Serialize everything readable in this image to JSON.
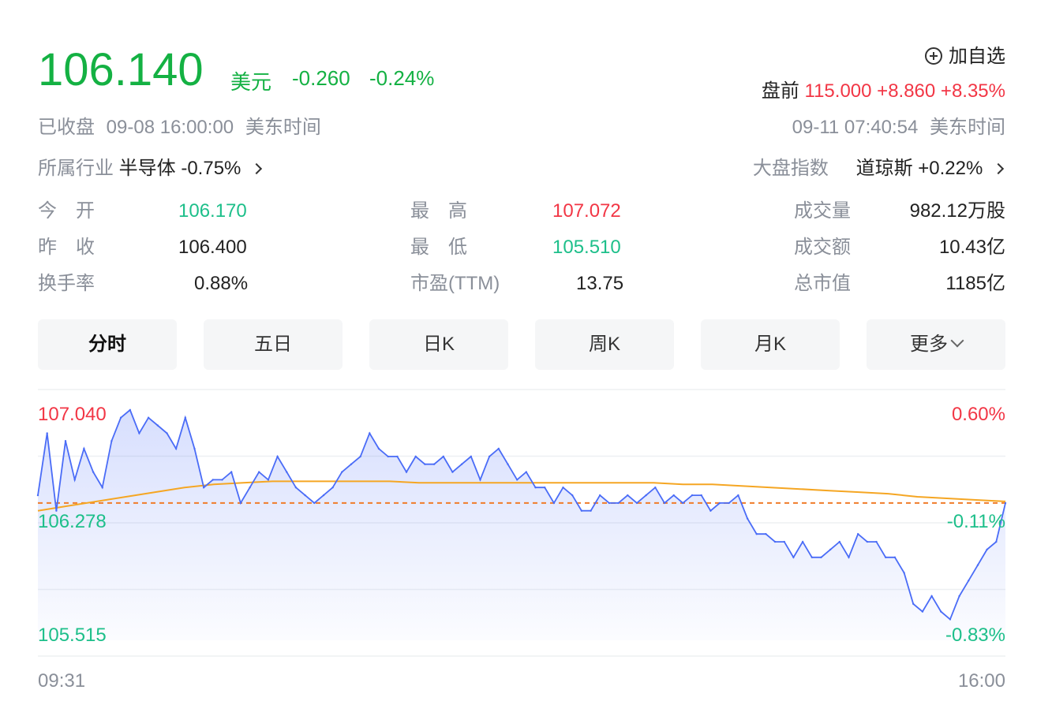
{
  "quote": {
    "price": "106.140",
    "currency": "美元",
    "change": "-0.260",
    "change_pct": "-0.24%",
    "add_watch": "加自选",
    "pre_label": "盘前",
    "pre_price": "115.000",
    "pre_change": "+8.860",
    "pre_change_pct": "+8.35%",
    "status": "已收盘",
    "close_time": "09-08 16:00:00",
    "tz": "美东时间",
    "pre_time": "09-11 07:40:54",
    "pre_tz": "美东时间"
  },
  "industry": {
    "label": "所属行业",
    "name": "半导体",
    "pct": "-0.75%"
  },
  "index": {
    "label": "大盘指数",
    "name": "道琼斯",
    "pct": "+0.22%"
  },
  "stats": {
    "open_label": "今　开",
    "open": "106.170",
    "high_label": "最　高",
    "high": "107.072",
    "volume_label": "成交量",
    "volume": "982.12万股",
    "prev_label": "昨　收",
    "prev": "106.400",
    "low_label": "最　低",
    "low": "105.510",
    "amount_label": "成交额",
    "amount": "10.43亿",
    "turnover_label": "换手率",
    "turnover": "0.88%",
    "pe_label": "市盈(TTM)",
    "pe": "13.75",
    "mcap_label": "总市值",
    "mcap": "1185亿"
  },
  "tabs": [
    "分时",
    "五日",
    "日K",
    "周K",
    "月K",
    "更多"
  ],
  "colors": {
    "down": "#14b143",
    "up": "#f23645",
    "price_line": "#4a6cf7",
    "avg_line": "#f5a623",
    "prev_close_line": "#f07c2a"
  },
  "chart_data": {
    "type": "line",
    "y_left_labels": [
      "107.040",
      "106.278",
      "105.515"
    ],
    "y_right_labels": [
      "0.60%",
      "-0.11%",
      "-0.83%"
    ],
    "x_labels": [
      "09:31",
      "16:00"
    ],
    "ylim": [
      105.515,
      107.04
    ],
    "prev_close": 106.4,
    "series": [
      {
        "values": [
          106.45,
          106.85,
          106.35,
          106.8,
          106.55,
          106.75,
          106.6,
          106.5,
          106.8,
          106.95,
          107.0,
          106.85,
          106.95,
          106.9,
          106.85,
          106.75,
          106.95,
          106.75,
          106.5,
          106.55,
          106.55,
          106.6,
          106.4,
          106.5,
          106.6,
          106.55,
          106.7,
          106.6,
          106.5,
          106.45,
          106.4,
          106.45,
          106.5,
          106.6,
          106.65,
          106.7,
          106.85,
          106.75,
          106.7,
          106.7,
          106.6,
          106.7,
          106.65,
          106.65,
          106.7,
          106.6,
          106.65,
          106.7,
          106.55,
          106.7,
          106.75,
          106.65,
          106.55,
          106.6,
          106.5,
          106.5,
          106.4,
          106.5,
          106.45,
          106.35,
          106.35,
          106.45,
          106.4,
          106.4,
          106.45,
          106.4,
          106.45,
          106.5,
          106.4,
          106.45,
          106.4,
          106.45,
          106.45,
          106.35,
          106.4,
          106.4,
          106.45,
          106.3,
          106.2,
          106.2,
          106.15,
          106.15,
          106.05,
          106.15,
          106.05,
          106.05,
          106.1,
          106.15,
          106.05,
          106.2,
          106.15,
          106.15,
          106.05,
          106.05,
          105.95,
          105.75,
          105.7,
          105.8,
          105.7,
          105.65,
          105.8,
          105.9,
          106.0,
          106.1,
          106.15,
          106.4
        ]
      },
      {
        "values": [
          106.35,
          106.38,
          106.41,
          106.44,
          106.47,
          106.5,
          106.52,
          106.53,
          106.54,
          106.54,
          106.54,
          106.54,
          106.54,
          106.53,
          106.53,
          106.53,
          106.53,
          106.53,
          106.53,
          106.53,
          106.53,
          106.53,
          106.52,
          106.52,
          106.51,
          106.5,
          106.49,
          106.48,
          106.47,
          106.46,
          106.44,
          106.43,
          106.42,
          106.41
        ]
      }
    ]
  }
}
